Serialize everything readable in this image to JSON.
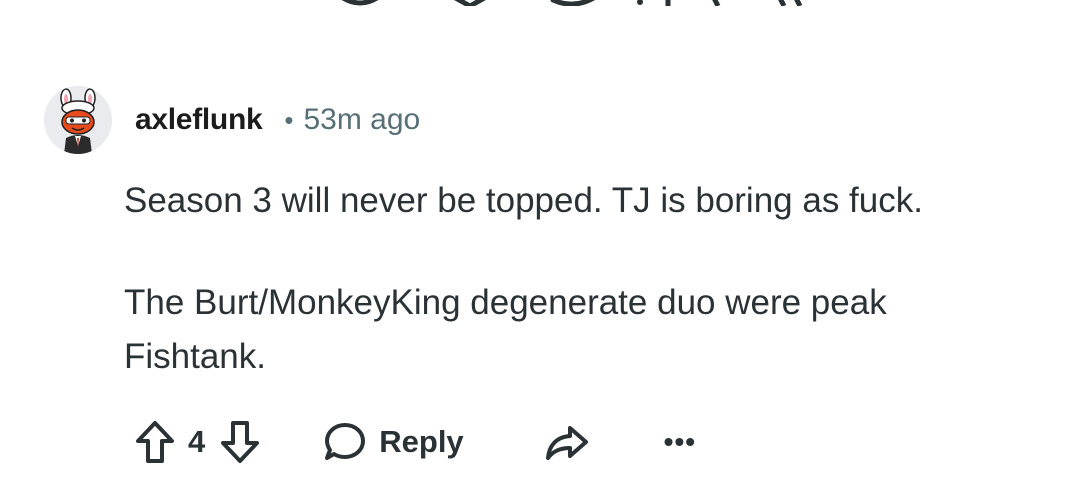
{
  "comment": {
    "username": "axleflunk",
    "separator": "•",
    "time": "53m ago",
    "paragraphs": [
      "Season 3 will never be topped. TJ is boring as fuck.",
      "The Burt/MonkeyKing degenerate duo were peak Fishtank."
    ],
    "score": "4",
    "reply_label": "Reply",
    "more_label": "•••"
  },
  "icons": {
    "upvote": "upvote-arrow-icon",
    "downvote": "downvote-arrow-icon",
    "reply": "speech-bubble-icon",
    "share": "share-arrow-icon",
    "more": "more-options-icon"
  },
  "colors": {
    "text": "#2a3236",
    "meta": "#576f76",
    "avatar_bg": "#e9ebee",
    "avatar_accent": "#e8491d"
  }
}
